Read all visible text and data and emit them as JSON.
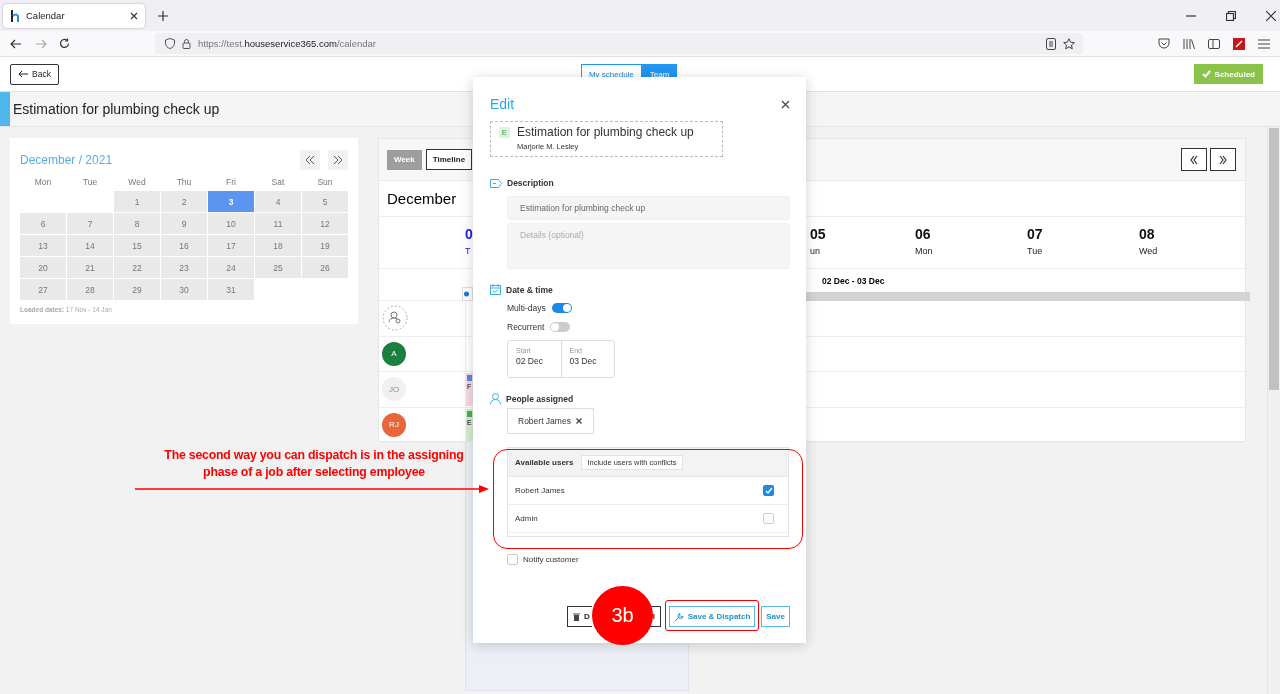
{
  "browser": {
    "tab_title": "Calendar",
    "url_start": "https://test.",
    "url_domain": "houseservice365.com",
    "url_path": "/calendar"
  },
  "header": {
    "back": "Back",
    "view_toggle": [
      {
        "label": "My schedule",
        "selected": false
      },
      {
        "label": "Team",
        "selected": true
      }
    ],
    "status": "Scheduled"
  },
  "title": "Estimation for plumbing check up",
  "mini_calendar": {
    "title": "December / 2021",
    "weekdays": [
      "Mon",
      "Tue",
      "Wed",
      "Thu",
      "Fri",
      "Sat",
      "Sun"
    ],
    "weeks": [
      [
        {
          "kind": "blank"
        },
        {
          "kind": "blank"
        },
        {
          "kind": "day",
          "label": "1",
          "selected": false
        },
        {
          "kind": "day",
          "label": "2",
          "selected": false
        },
        {
          "kind": "day",
          "label": "3",
          "selected": true
        },
        {
          "kind": "day",
          "label": "4",
          "selected": false
        },
        {
          "kind": "day",
          "label": "5",
          "selected": false
        }
      ],
      [
        {
          "kind": "day",
          "label": "6",
          "selected": false
        },
        {
          "kind": "day",
          "label": "7",
          "selected": false
        },
        {
          "kind": "day",
          "label": "8",
          "selected": false
        },
        {
          "kind": "day",
          "label": "9",
          "selected": false
        },
        {
          "kind": "day",
          "label": "10",
          "selected": false
        },
        {
          "kind": "day",
          "label": "11",
          "selected": false
        },
        {
          "kind": "day",
          "label": "12",
          "selected": false
        }
      ],
      [
        {
          "kind": "day",
          "label": "13",
          "selected": false
        },
        {
          "kind": "day",
          "label": "14",
          "selected": false
        },
        {
          "kind": "day",
          "label": "15",
          "selected": false
        },
        {
          "kind": "day",
          "label": "16",
          "selected": false
        },
        {
          "kind": "day",
          "label": "17",
          "selected": false
        },
        {
          "kind": "day",
          "label": "18",
          "selected": false
        },
        {
          "kind": "day",
          "label": "19",
          "selected": false
        }
      ],
      [
        {
          "kind": "day",
          "label": "20",
          "selected": false
        },
        {
          "kind": "day",
          "label": "21",
          "selected": false
        },
        {
          "kind": "day",
          "label": "22",
          "selected": false
        },
        {
          "kind": "day",
          "label": "23",
          "selected": false
        },
        {
          "kind": "day",
          "label": "24",
          "selected": false
        },
        {
          "kind": "day",
          "label": "25",
          "selected": false
        },
        {
          "kind": "day",
          "label": "26",
          "selected": false
        }
      ],
      [
        {
          "kind": "day",
          "label": "27",
          "selected": false
        },
        {
          "kind": "day",
          "label": "28",
          "selected": false
        },
        {
          "kind": "day",
          "label": "29",
          "selected": false
        },
        {
          "kind": "day",
          "label": "30",
          "selected": false
        },
        {
          "kind": "day",
          "label": "31",
          "selected": false
        }
      ]
    ],
    "loaded": "**Loaded dates:** 17 Nov - 14 Jan"
  },
  "timeline": {
    "view_tabs": [
      {
        "label": "Week",
        "selected": false
      },
      {
        "label": "Timeline",
        "selected": true
      }
    ],
    "month": "December",
    "days": [
      {
        "number": "0",
        "weekday": "T",
        "today": true
      },
      {
        "number": "05",
        "weekday": "un",
        "today": false
      },
      {
        "number": "06",
        "weekday": "Mon",
        "today": false
      },
      {
        "number": "07",
        "weekday": "Tue",
        "today": false
      },
      {
        "number": "08",
        "weekday": "Wed",
        "today": false
      }
    ],
    "range_label": "02 Dec - 03 Dec",
    "resources": [
      {
        "kind": "unassigned"
      },
      {
        "kind": "avatar",
        "initials": "A",
        "color": "#1b7f3e",
        "inactive": false
      },
      {
        "kind": "avatar",
        "initials": "JO",
        "color": "#f0f0f0",
        "inactive": true,
        "event": {
          "color": "#f7d9e3",
          "badge": {
            "color": "#4a90e2"
          },
          "text": "F"
        }
      },
      {
        "kind": "avatar",
        "initials": "RJ",
        "color": "#e8673a",
        "inactive": false,
        "event": {
          "color": "#d6ecd2",
          "badge": {
            "color": "#4caf50"
          },
          "text": "E"
        }
      }
    ]
  },
  "edit_dialog": {
    "title": "Edit",
    "job": {
      "badge": "E",
      "name": "Estimation for plumbing check up",
      "customer": "Marjorie M. Lesley"
    },
    "description": {
      "label": "Description",
      "value": "Estimation for plumbing check up",
      "details_placeholder": "Details (optional)"
    },
    "date_time": {
      "label": "Date & time",
      "toggles": [
        {
          "label": "Multi-days",
          "on": true
        },
        {
          "label": "Recurrent",
          "on": false
        }
      ],
      "start_label": "Start",
      "start": "02 Dec",
      "end_label": "End",
      "end": "03 Dec"
    },
    "people": {
      "label": "People assigned",
      "chips": [
        "Robert James"
      ],
      "available_title": "Available users",
      "filter_button": "Include users with conflicts",
      "users": [
        {
          "name": "Robert James",
          "checked": true
        },
        {
          "name": "Admin",
          "checked": false
        }
      ]
    },
    "notify": {
      "label": "Notify customer",
      "checked": false
    },
    "buttons": [
      {
        "kind": "delete",
        "label": "D"
      },
      {
        "kind": "cancel",
        "label": "l"
      },
      {
        "kind": "dispatch",
        "label": "Save & Dispatch"
      },
      {
        "kind": "save",
        "label": "Save"
      }
    ]
  },
  "annotation": {
    "text": "The second way you can dispatch is in the assigning phase of a job after selecting employee",
    "step": "3b"
  }
}
